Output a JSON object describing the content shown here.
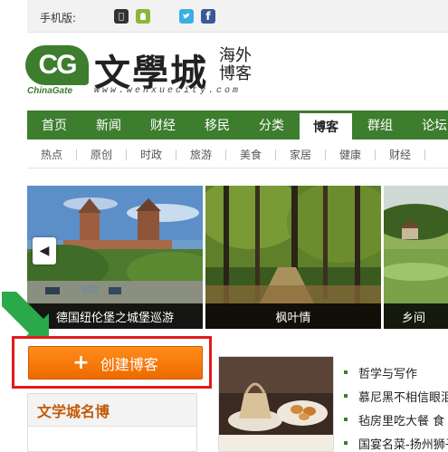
{
  "mobile": {
    "label": "手机版:",
    "icons": [
      "apple-icon",
      "android-icon",
      "twitter-icon",
      "facebook-icon"
    ]
  },
  "logo": {
    "cg": "CG",
    "chinagate": "ChinaGate",
    "title": "文學城",
    "url": "www.wenxuecity.com",
    "overseas": "海外博客"
  },
  "nav": {
    "items": [
      "首页",
      "新闻",
      "财经",
      "移民",
      "分类",
      "博客",
      "群组",
      "论坛"
    ],
    "active_index": 5
  },
  "subnav": {
    "items": [
      "热点",
      "原创",
      "时政",
      "旅游",
      "美食",
      "家居",
      "健康",
      "财经",
      "I"
    ]
  },
  "slider": {
    "captions": [
      "德国纽伦堡之城堡巡游",
      "枫叶情",
      "乡间"
    ],
    "prev_icon": "chevron-left-icon"
  },
  "create": {
    "label": "创建博客"
  },
  "famous": {
    "title": "文学城名博"
  },
  "articles": [
    "哲学与写作",
    "慕尼黑不相信眼泪",
    "毡房里吃大餐 食",
    "国宴名菜-扬州狮子头"
  ],
  "colors": {
    "brand_green": "#3d7d2e",
    "orange": "#ff7f0a",
    "highlight_red": "#e21b1b",
    "famous_title": "#c25b0a"
  }
}
